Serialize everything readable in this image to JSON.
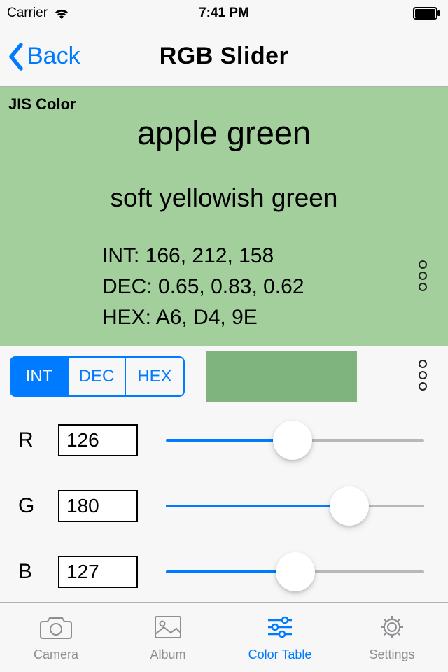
{
  "status": {
    "carrier": "Carrier",
    "time": "7:41 PM"
  },
  "nav": {
    "back": "Back",
    "title": "RGB Slider"
  },
  "panel": {
    "label": "JIS Color",
    "color_name": "apple green",
    "mood_name": "soft yellowish green",
    "int_line": "INT: 166, 212, 158",
    "dec_line": "DEC: 0.65, 0.83, 0.62",
    "hex_line": "HEX: A6, D4, 9E",
    "bg": "#a2cf9c"
  },
  "seg": {
    "int": "INT",
    "dec": "DEC",
    "hex": "HEX",
    "active": "INT"
  },
  "swatch": "#7fb47f",
  "sliders": {
    "r": {
      "label": "R",
      "value": "126",
      "pct": 49
    },
    "g": {
      "label": "G",
      "value": "180",
      "pct": 71
    },
    "b": {
      "label": "B",
      "value": "127",
      "pct": 50
    }
  },
  "tabs": {
    "camera": "Camera",
    "album": "Album",
    "colortable": "Color Table",
    "settings": "Settings",
    "active": "colortable"
  }
}
